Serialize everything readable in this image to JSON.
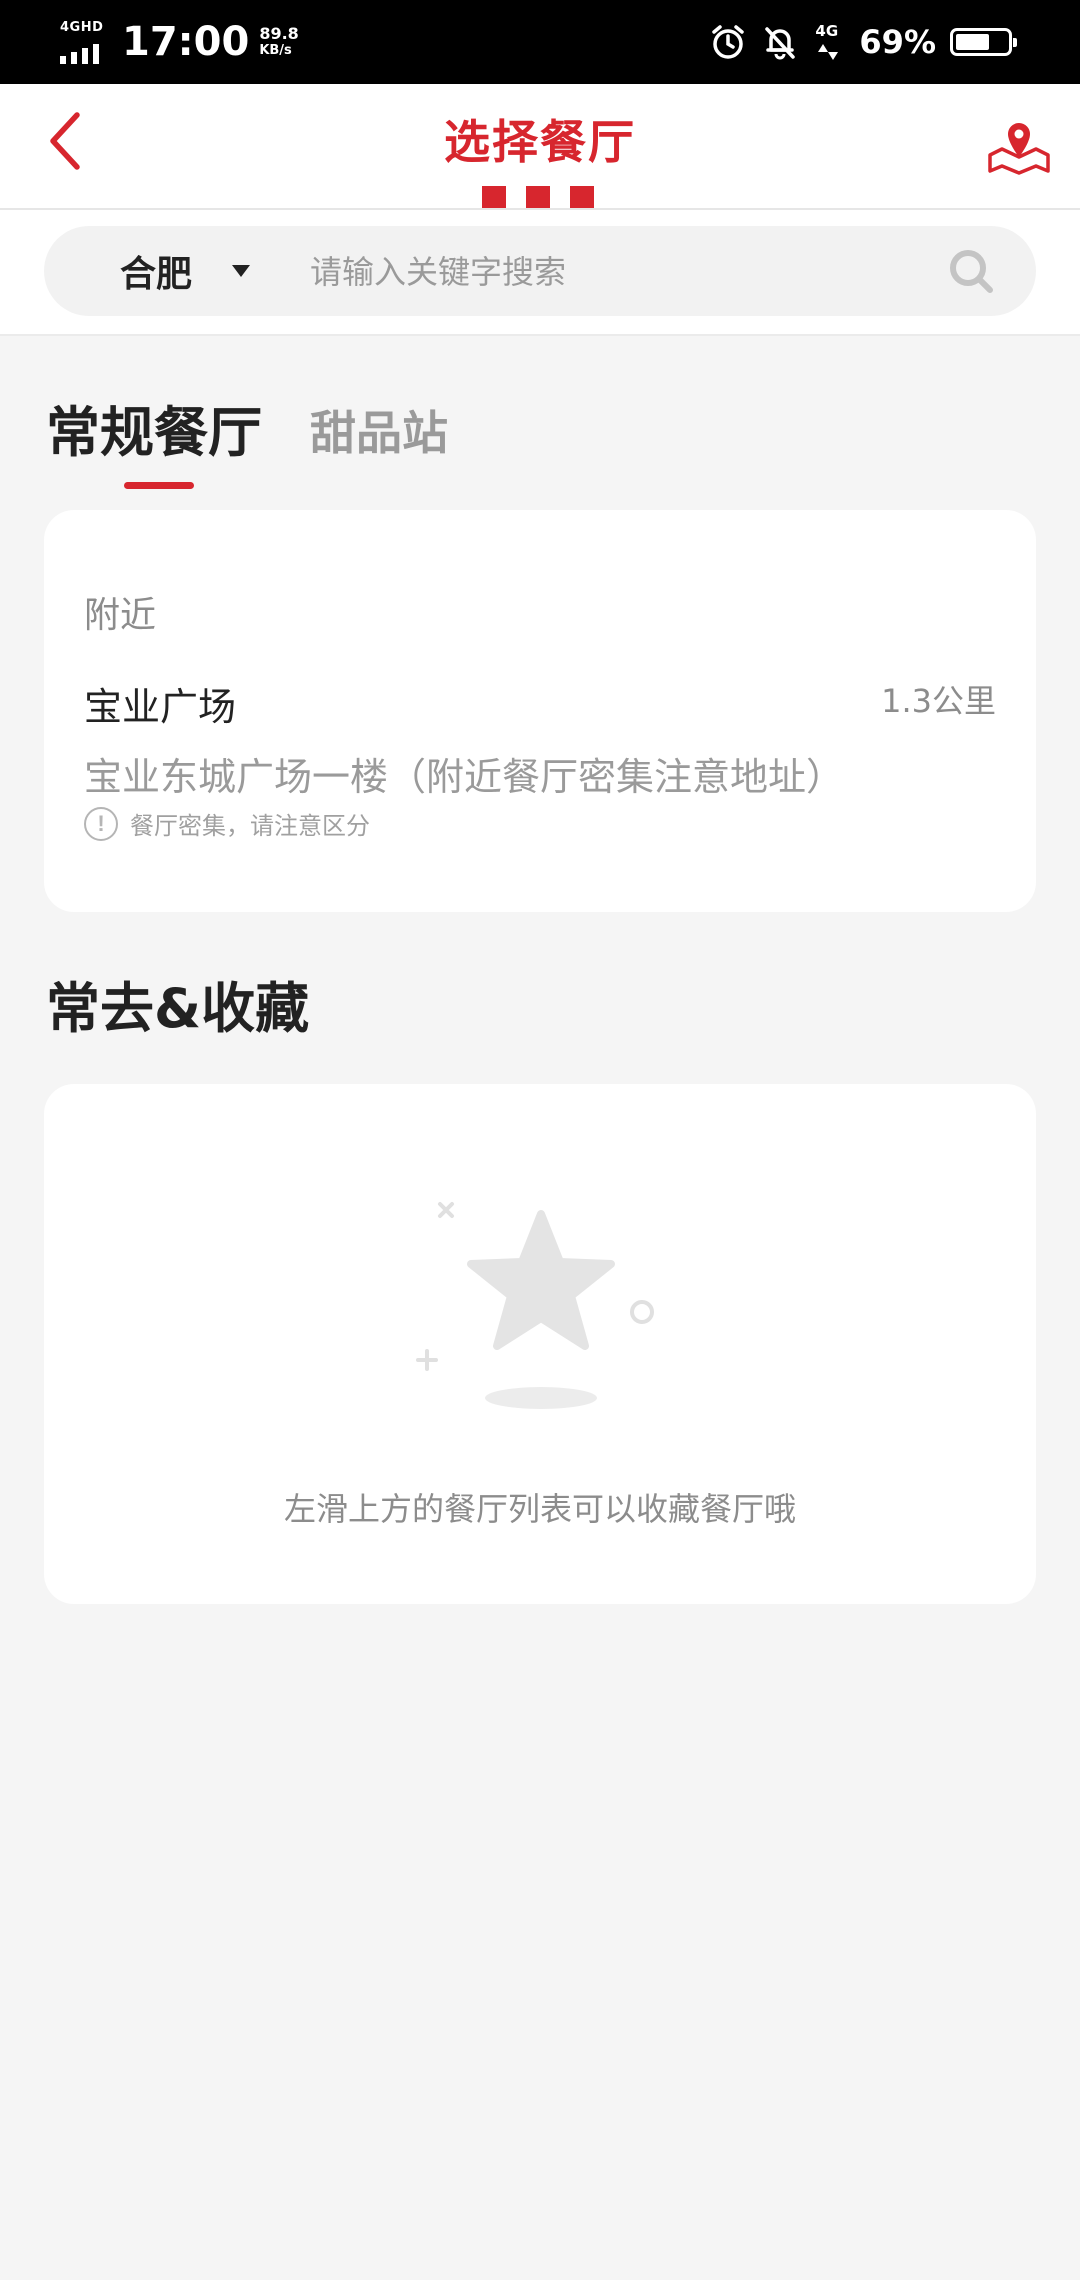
{
  "status_bar": {
    "network": "4GHD",
    "time": "17:00",
    "speed_value": "89.8",
    "speed_unit": "KB/s",
    "mobile_data": "4G",
    "battery_percent": "69%",
    "battery_level": 0.69,
    "icons": [
      "alarm-icon",
      "bell-muted-icon",
      "data-arrows-icon",
      "battery-icon"
    ]
  },
  "header": {
    "title": "选择餐厅",
    "back_icon": "chevron-left-icon",
    "map_icon": "map-pin-icon",
    "accent_color": "#d7262e"
  },
  "search": {
    "city": "合肥",
    "placeholder": "请输入关键字搜索",
    "value": "",
    "icon": "search-icon"
  },
  "tabs": [
    {
      "label": "常规餐厅",
      "active": true
    },
    {
      "label": "甜品站",
      "active": false
    }
  ],
  "nearby": {
    "label": "附近",
    "restaurant": {
      "name": "宝业广场",
      "distance": "1.3公里",
      "address": "宝业东城广场一楼（附近餐厅密集注意地址）",
      "warning": "餐厅密集，请注意区分"
    }
  },
  "favorites": {
    "heading": "常去&收藏",
    "empty_text": "左滑上方的餐厅列表可以收藏餐厅哦",
    "empty_icon": "star-icon"
  }
}
